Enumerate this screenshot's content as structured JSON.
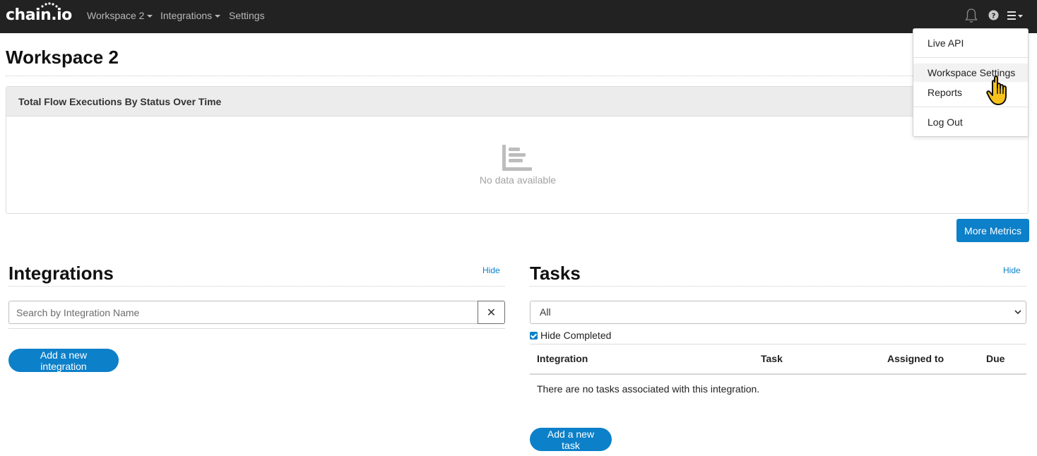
{
  "navbar": {
    "brand": "chain.io",
    "workspace_menu": "Workspace 2",
    "integrations_menu": "Integrations",
    "settings_link": "Settings",
    "icons": [
      "bell-icon",
      "help-icon",
      "hamburger-menu-icon"
    ]
  },
  "page": {
    "title": "Workspace 2"
  },
  "chart_card": {
    "title": "Total Flow Executions By Status Over Time",
    "empty_icon": "bar-chart-icon",
    "empty_text": "No data available"
  },
  "more_metrics_label": "More Metrics",
  "integrations": {
    "title": "Integrations",
    "hide_label": "Hide",
    "search_placeholder": "Search by Integration Name",
    "clear_label": "✕",
    "add_label": "Add a new integration"
  },
  "tasks": {
    "title": "Tasks",
    "hide_label": "Hide",
    "filter_value": "All",
    "hide_completed_label": "Hide Completed",
    "hide_completed_checked": true,
    "columns": [
      "Integration",
      "Task",
      "Assigned to",
      "Due"
    ],
    "empty_text": "There are no tasks associated with this integration.",
    "add_label": "Add a new task"
  },
  "user_menu": {
    "items": [
      "Live API",
      "Workspace Settings",
      "Reports",
      "Log Out"
    ],
    "hovered": "Workspace Settings"
  },
  "colors": {
    "navbar": "#222222",
    "primary": "#0c80c9"
  }
}
